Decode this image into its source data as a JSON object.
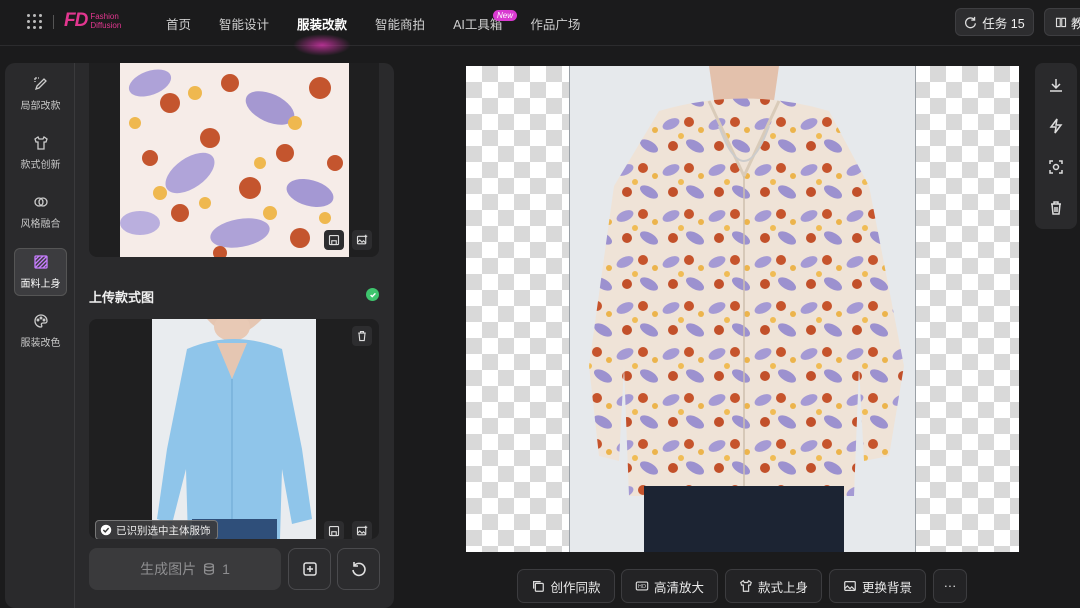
{
  "app": {
    "logo_mark": "FD",
    "logo_line1": "Fashion",
    "logo_line2": "Diffusion"
  },
  "nav": {
    "items": [
      {
        "label": "首页"
      },
      {
        "label": "智能设计"
      },
      {
        "label": "服装改款",
        "active": true
      },
      {
        "label": "智能商拍"
      },
      {
        "label": "AI工具箱"
      },
      {
        "label": "作品广场"
      }
    ],
    "new_badge": "New"
  },
  "header": {
    "task_label": "任务 15",
    "doc_label": "教"
  },
  "sidebar": {
    "items": [
      {
        "label": "局部改款"
      },
      {
        "label": "款式创新"
      },
      {
        "label": "风格融合"
      },
      {
        "label": "面料上身",
        "active": true
      },
      {
        "label": "服装改色"
      }
    ]
  },
  "upload": {
    "title": "上传款式图",
    "recognized_label": "已识别选中主体服饰"
  },
  "generate": {
    "label": "生成图片",
    "credits": "1"
  },
  "bottom_actions": [
    {
      "label": "创作同款"
    },
    {
      "label": "高清放大"
    },
    {
      "label": "款式上身"
    },
    {
      "label": "更换背景"
    },
    {
      "label": "···"
    }
  ],
  "colors": {
    "accent": "#e2368f",
    "success": "#3ec46d",
    "badge": "#d93ad1"
  }
}
